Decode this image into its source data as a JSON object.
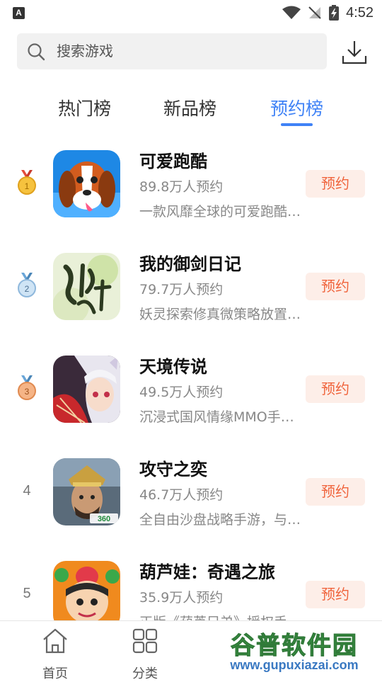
{
  "status_bar": {
    "time": "4:52",
    "left_icon": "A"
  },
  "search": {
    "placeholder": "搜索游戏"
  },
  "tabs": [
    {
      "label": "热门榜",
      "active": false
    },
    {
      "label": "新品榜",
      "active": false
    },
    {
      "label": "预约榜",
      "active": true
    }
  ],
  "games": [
    {
      "rank": "1",
      "medal": "gold",
      "title": "可爱跑酷",
      "count": "89.8万人预约",
      "desc": "一款风靡全球的可爱跑酷…",
      "button": "预约"
    },
    {
      "rank": "2",
      "medal": "silver",
      "title": "我的御剑日记",
      "count": "79.7万人预约",
      "desc": "妖灵探索修真微策略放置…",
      "button": "预约"
    },
    {
      "rank": "3",
      "medal": "bronze",
      "title": "天境传说",
      "count": "49.5万人预约",
      "desc": "沉浸式国风情缘MMO手…",
      "button": "预约"
    },
    {
      "rank": "4",
      "medal": null,
      "title": "攻守之奕",
      "count": "46.7万人预约",
      "desc": "全自由沙盘战略手游，与…",
      "button": "预约"
    },
    {
      "rank": "5",
      "medal": null,
      "title": "葫芦娃：奇遇之旅",
      "count": "35.9万人预约",
      "desc": "正版《葫芦兄弟》授权手…",
      "button": "预约"
    }
  ],
  "bottom_nav": [
    {
      "label": "首页",
      "icon": "home-icon"
    },
    {
      "label": "分类",
      "icon": "grid-icon"
    }
  ],
  "watermark": {
    "title": "谷普软件园",
    "url": "www.gupuxiazai.com"
  },
  "colors": {
    "accent": "#3f82f6",
    "button_bg": "#fdeee8",
    "button_text": "#f0643c"
  }
}
